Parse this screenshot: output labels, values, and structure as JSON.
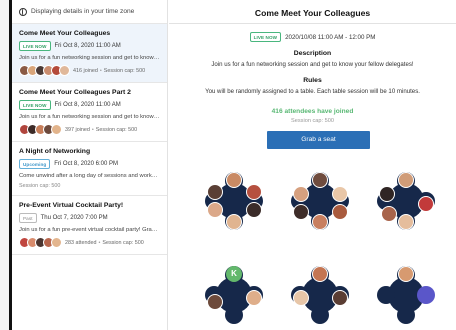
{
  "sidebar": {
    "timezone_text": "Displaying details in your time zone",
    "sessions": [
      {
        "title": "Come Meet Your Colleagues",
        "badge": "LIVE NOW",
        "datetime": "Fri Oct 8, 2020 11:00 AM",
        "description": "Join us for a fun networking session and get to know your fello...",
        "attendance": "416 joined",
        "capacity": "Session cap: 500"
      },
      {
        "title": "Come Meet Your Colleagues Part 2",
        "badge": "LIVE NOW",
        "datetime": "Fri Oct 8, 2020 11:00 AM",
        "description": "Join us for a fun networking session and get to know your fello...",
        "attendance": "397 joined",
        "capacity": "Session cap: 500"
      },
      {
        "title": "A Night of Networking",
        "badge": "Upcoming",
        "datetime": "Fri Oct 8, 2020 6:00 PM",
        "description": "Come unwind after a long day of sessions and workshops. Gat...",
        "capacity": "Session cap: 500"
      },
      {
        "title": "Pre-Event Virtual Cocktail Party!",
        "badge": "Past",
        "datetime": "Thu Oct 7, 2020 7:00 PM",
        "description": "Join us for a fun pre-event virtual cocktail party! Grab your drin...",
        "attendance": "283 attended",
        "capacity": "Session cap: 500"
      }
    ]
  },
  "main": {
    "title": "Come Meet Your Colleagues",
    "badge": "LIVE NOW",
    "datetime_range": "2020/10/08 11:00 AM - 12:00 PM",
    "description_heading": "Description",
    "description_text": "Join us for a fun networking session and get to know your fellow delegates!",
    "rules_heading": "Rules",
    "rules_text": "You will be randomly assigned to a table. Each table session will be 10 minutes.",
    "joined_text": "416 attendees have joined",
    "capacity_text": "Session cap: 500",
    "grab_button": "Grab a seat",
    "initial_seat": "K"
  },
  "colors": {
    "live": "#2f9e63",
    "upcoming": "#3b95c9",
    "primary_button": "#2b6fb6",
    "table": "#16284a",
    "joined_text": "#59b874"
  }
}
